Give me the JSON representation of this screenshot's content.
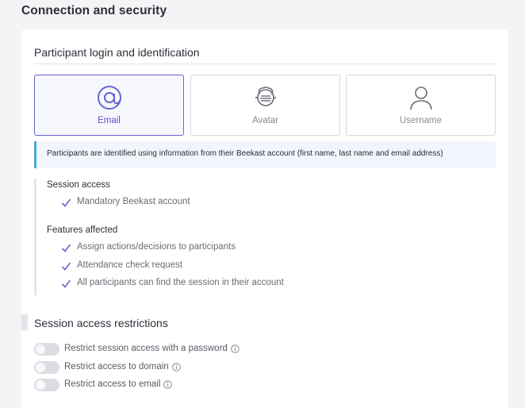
{
  "page": {
    "title": "Connection and security"
  },
  "login": {
    "heading": "Participant login and identification",
    "options": [
      {
        "label": "Email",
        "icon": "at-sign-icon",
        "selected": true
      },
      {
        "label": "Avatar",
        "icon": "avatar-face-icon",
        "selected": false
      },
      {
        "label": "Username",
        "icon": "user-icon",
        "selected": false
      }
    ],
    "info": "Participants are identified using information from their Beekast account (first name, last name and email address)"
  },
  "session_access": {
    "heading": "Session access",
    "items": [
      "Mandatory Beekast account"
    ]
  },
  "features_affected": {
    "heading": "Features affected",
    "items": [
      "Assign actions/decisions to participants",
      "Attendance check request",
      "All participants can find the session in their account"
    ]
  },
  "restrictions": {
    "heading": "Session access restrictions",
    "toggles": [
      {
        "label": "Restrict session access with a password",
        "enabled": false
      },
      {
        "label": "Restrict access to domain",
        "enabled": false
      },
      {
        "label": "Restrict access to email",
        "enabled": false
      }
    ]
  },
  "colors": {
    "accent": "#6a63d3",
    "info_border": "#4aa6d8",
    "check": "#6a63d3",
    "toggle_off": "#dcdde3"
  }
}
